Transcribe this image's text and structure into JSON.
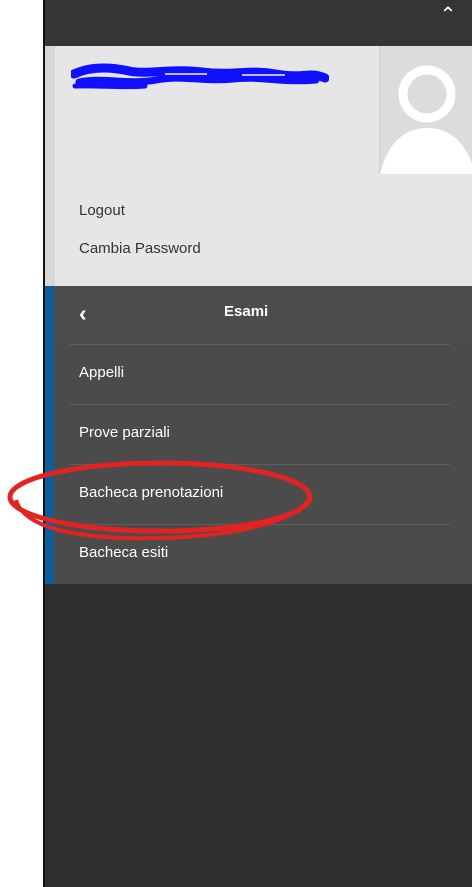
{
  "header": {
    "collapse_icon": "chevron-up-icon"
  },
  "user": {
    "name": "",
    "name_redacted": true,
    "avatar_icon": "user-avatar-icon",
    "logout_label": "Logout",
    "change_password_label": "Cambia Password"
  },
  "menu": {
    "back_icon": "chevron-left-icon",
    "title": "Esami",
    "items": [
      {
        "label": "Appelli"
      },
      {
        "label": "Prove parziali"
      },
      {
        "label": "Bacheca prenotazioni",
        "highlighted": true
      },
      {
        "label": "Bacheca esiti"
      }
    ]
  },
  "colors": {
    "panel_background": "#2f2f2f",
    "menu_background": "#4b4b4b",
    "accent": "#0b5e9b",
    "user_panel_background": "#e6e6e6",
    "annotation": "#e32222",
    "redaction": "#1010ff"
  }
}
